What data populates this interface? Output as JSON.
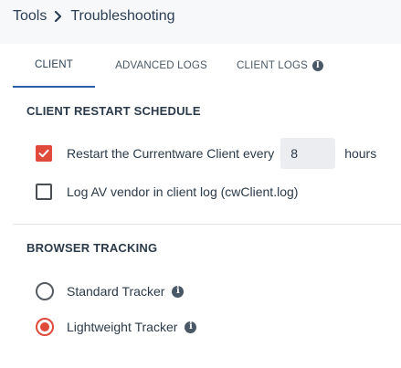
{
  "breadcrumb": {
    "parent": "Tools",
    "current": "Troubleshooting"
  },
  "tabs": [
    {
      "label": "CLIENT",
      "active": true
    },
    {
      "label": "ADVANCED LOGS",
      "active": false
    },
    {
      "label": "CLIENT LOGS",
      "active": false
    }
  ],
  "restart_schedule": {
    "title": "CLIENT RESTART SCHEDULE",
    "restart_label": "Restart the Currentware Client every",
    "restart_checked": true,
    "hours_value": "8",
    "hours_unit": "hours",
    "log_av_label": "Log AV vendor in client log (cwClient.log)",
    "log_av_checked": false
  },
  "browser_tracking": {
    "title": "BROWSER TRACKING",
    "options": [
      {
        "label": "Standard Tracker",
        "selected": false
      },
      {
        "label": "Lightweight Tracker",
        "selected": true
      }
    ]
  },
  "colors": {
    "accent": "#e04a3b",
    "tab_underline": "#2a5ea8",
    "text": "#2b3a4a"
  },
  "icons": {
    "breadcrumb_separator": "chevron-right-icon",
    "info": "info-icon",
    "check": "check-icon"
  }
}
